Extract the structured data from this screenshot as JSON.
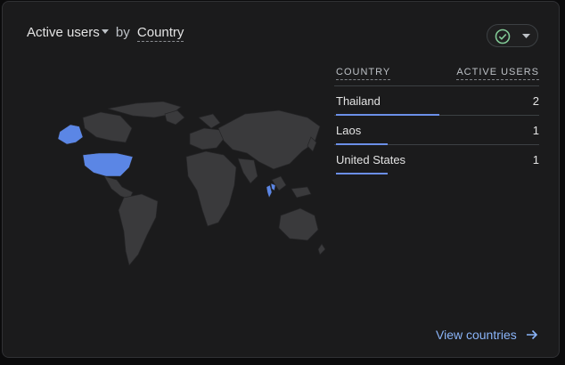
{
  "header": {
    "metric": "Active users",
    "by": "by",
    "dimension": "Country"
  },
  "colors": {
    "highlight": "#5b86e5",
    "land": "#3a3a3c",
    "accent": "#8ab4f8",
    "check": "#81c995"
  },
  "status": {
    "icon": "check-circle-icon",
    "menu_icon": "chevron-down-icon"
  },
  "table": {
    "headers": {
      "country": "COUNTRY",
      "active_users": "ACTIVE USERS"
    },
    "rows": [
      {
        "country": "Thailand",
        "value": "2",
        "share": 1.0
      },
      {
        "country": "Laos",
        "value": "1",
        "share": 0.5
      },
      {
        "country": "United States",
        "value": "1",
        "share": 0.5
      }
    ]
  },
  "footer": {
    "link": "View countries",
    "icon": "arrow-right-icon"
  }
}
